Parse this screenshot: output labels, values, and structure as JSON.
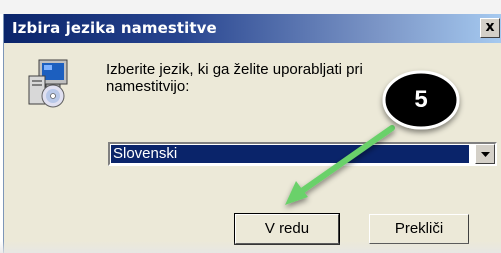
{
  "dialog": {
    "title": "Izbira jezika namestitve",
    "close_glyph": "x",
    "prompt_line1": "Izberite jezik, ki ga želite uporabljati pri",
    "prompt_line2": "namestitvijo:",
    "icon": "setup-computer-cd-icon"
  },
  "language_select": {
    "selected": "Slovenski"
  },
  "buttons": {
    "ok_label": "V redu",
    "cancel_label": "Prekliči"
  },
  "annotation": {
    "step_number": "5",
    "arrow_color": "#6bd16b",
    "badge_color": "#000000"
  },
  "colors": {
    "titlebar_start": "#0a246a",
    "titlebar_end": "#a6caf0",
    "dialog_bg": "#ece9d8",
    "selection_bg": "#0a246a"
  }
}
